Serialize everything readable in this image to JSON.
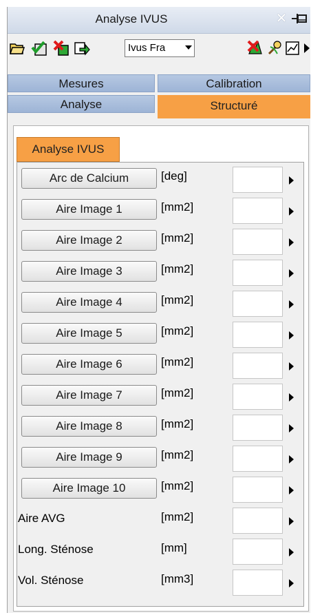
{
  "window": {
    "title": "Analyse IVUS"
  },
  "toolbar": {
    "combo_value": "Ivus Fra",
    "icons": [
      "open-folder-icon",
      "check-save-icon",
      "delete-icon",
      "export-icon",
      "delete-measure-icon",
      "tools-icon",
      "chart-icon",
      "more-arrow-icon"
    ]
  },
  "tabs": {
    "row1": [
      "Mesures",
      "Calibration"
    ],
    "row2": [
      "Analyse",
      "Structuré"
    ],
    "active": "Structuré"
  },
  "subtab": {
    "label": "Analyse IVUS"
  },
  "measures": [
    {
      "label": "Arc de Calcium",
      "unit": "[deg]",
      "value": "",
      "button": true
    },
    {
      "label": "Aire Image 1",
      "unit": "[mm2]",
      "value": "",
      "button": true
    },
    {
      "label": "Aire Image 2",
      "unit": "[mm2]",
      "value": "",
      "button": true
    },
    {
      "label": "Aire Image 3",
      "unit": "[mm2]",
      "value": "",
      "button": true
    },
    {
      "label": "Aire Image 4",
      "unit": "[mm2]",
      "value": "",
      "button": true
    },
    {
      "label": "Aire Image 5",
      "unit": "[mm2]",
      "value": "",
      "button": true
    },
    {
      "label": "Aire Image 6",
      "unit": "[mm2]",
      "value": "",
      "button": true
    },
    {
      "label": "Aire Image 7",
      "unit": "[mm2]",
      "value": "",
      "button": true
    },
    {
      "label": "Aire Image 8",
      "unit": "[mm2]",
      "value": "",
      "button": true
    },
    {
      "label": "Aire Image 9",
      "unit": "[mm2]",
      "value": "",
      "button": true
    },
    {
      "label": "Aire Image 10",
      "unit": "[mm2]",
      "value": "",
      "button": true
    },
    {
      "label": "Aire AVG",
      "unit": "[mm2]",
      "value": "",
      "button": false
    },
    {
      "label": "Long. Sténose",
      "unit": "[mm]",
      "value": "",
      "button": false
    },
    {
      "label": "Vol. Sténose",
      "unit": "[mm3]",
      "value": "",
      "button": false
    }
  ],
  "colors": {
    "active_tab": "#f7a045",
    "inactive_tab": "#aabfde"
  }
}
